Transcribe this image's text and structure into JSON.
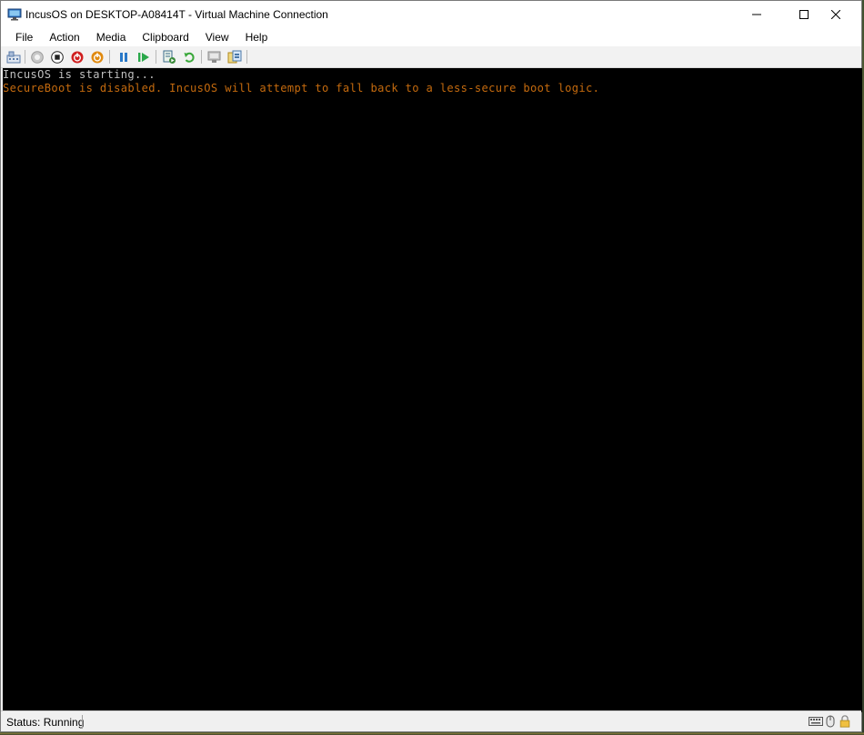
{
  "window": {
    "title": "IncusOS on DESKTOP-A08414T - Virtual Machine Connection",
    "controls": {
      "minimize": "–",
      "maximize": "☐",
      "close": "✕"
    }
  },
  "menu": {
    "items": [
      "File",
      "Action",
      "Media",
      "Clipboard",
      "View",
      "Help"
    ]
  },
  "toolbar": {
    "buttons": [
      {
        "icon": "ctrl-alt-del-icon",
        "color": "#5a7aa8"
      },
      {
        "icon": "start-icon",
        "color": "#9a9a9a"
      },
      {
        "icon": "turn-off-icon",
        "color": "#222222"
      },
      {
        "icon": "shut-down-icon",
        "color": "#d02020"
      },
      {
        "icon": "save-icon",
        "color": "#e08a10"
      },
      {
        "icon": "pause-icon",
        "color": "#2a78c8"
      },
      {
        "icon": "resume-icon",
        "color": "#2aa84a"
      },
      {
        "icon": "checkpoint-icon",
        "color": "#3a8a3a"
      },
      {
        "icon": "revert-icon",
        "color": "#3aa83a"
      },
      {
        "icon": "enhanced-session-icon",
        "color": "#8a8a8a"
      },
      {
        "icon": "share-icon",
        "color": "#d8b040"
      }
    ]
  },
  "console": {
    "lines": [
      {
        "text": "IncusOS is starting...",
        "color": "#c0c0c0"
      },
      {
        "text": "SecureBoot is disabled. IncusOS will attempt to fall back to a less-secure boot logic.",
        "color": "#c46a0e"
      }
    ]
  },
  "status": {
    "text": "Status: Running",
    "icons": [
      "keyboard-icon",
      "mouse-icon",
      "lock-icon"
    ]
  }
}
